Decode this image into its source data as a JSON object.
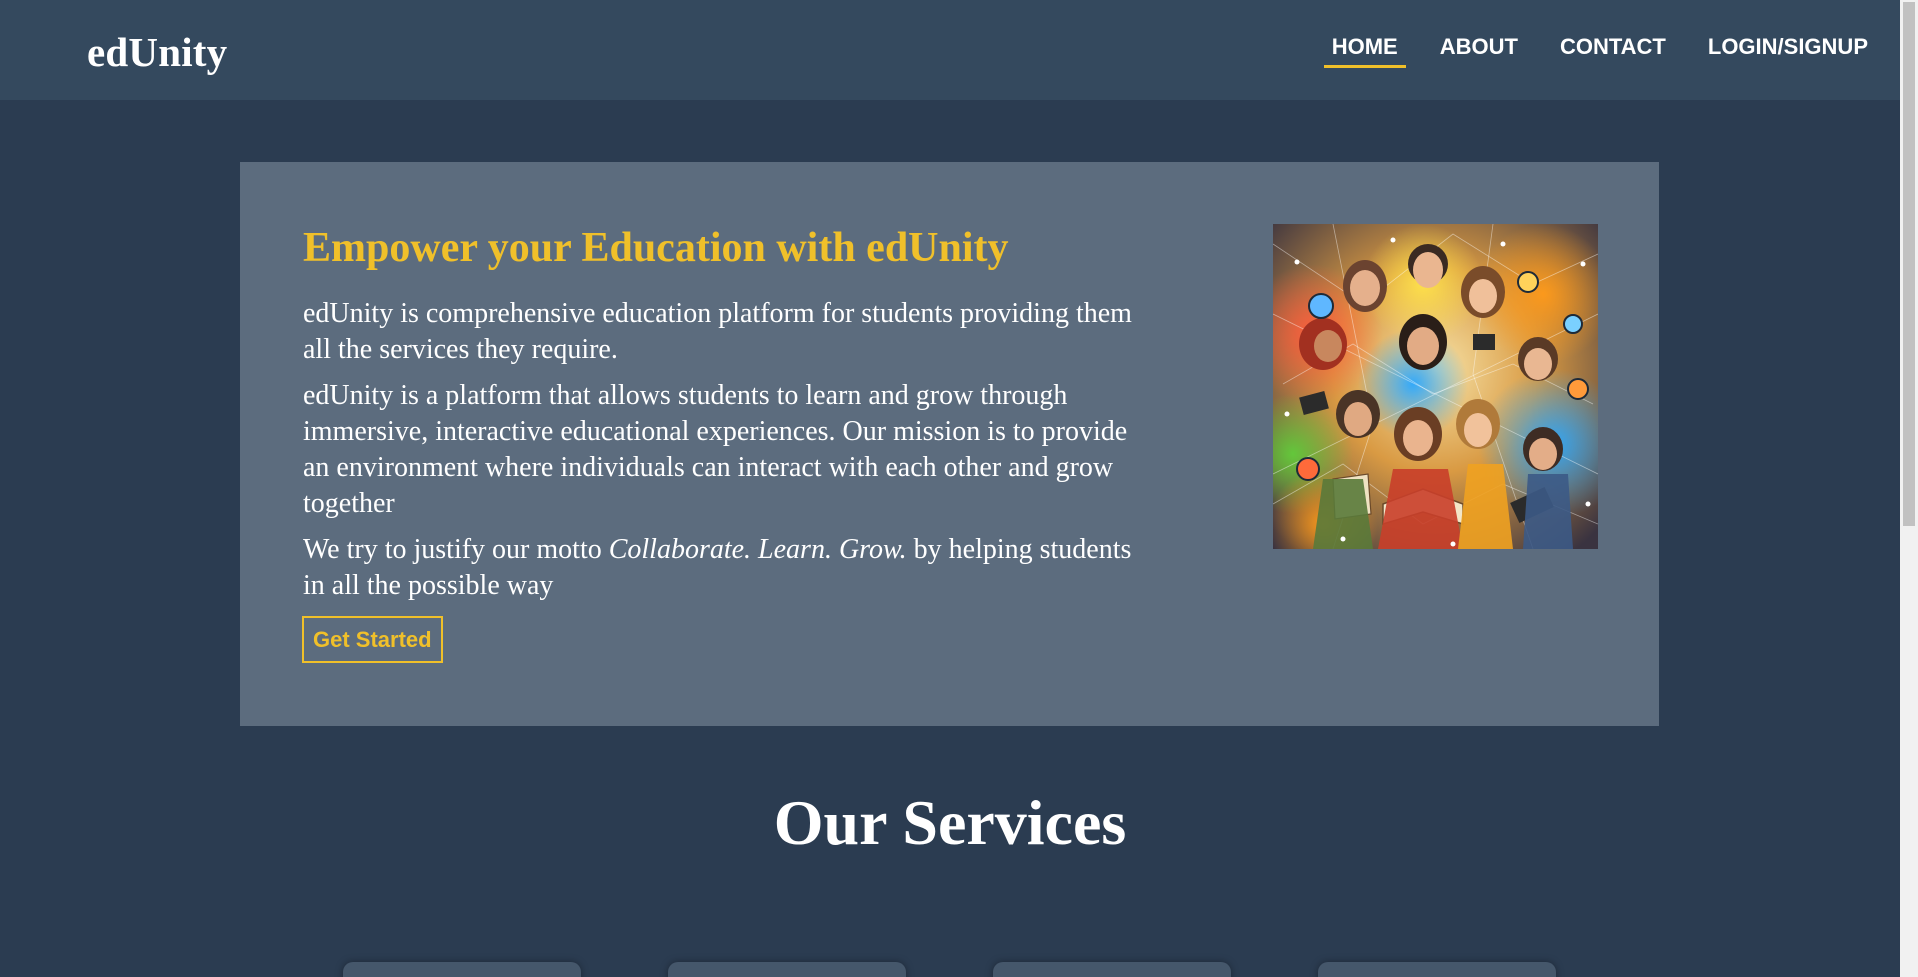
{
  "header": {
    "logo": "edUnity",
    "nav": [
      {
        "label": "HOME",
        "active": true
      },
      {
        "label": "ABOUT",
        "active": false
      },
      {
        "label": "CONTACT",
        "active": false
      },
      {
        "label": "LOGIN/SIGNUP",
        "active": false
      }
    ]
  },
  "hero": {
    "title": "Empower your Education with edUnity",
    "paragraph1": "edUnity is comprehensive education platform for students providing them all the services they require.",
    "paragraph2": "edUnity is a platform that allows students to learn and grow through immersive, interactive educational experiences. Our mission is to provide an environment where individuals can interact with each other and grow together",
    "paragraph3_before": "We try to justify our motto ",
    "paragraph3_motto": "Collaborate. Learn. Grow.",
    "paragraph3_after": " by helping students in all the possible way",
    "cta_label": "Get Started"
  },
  "services": {
    "title": "Our Services"
  },
  "colors": {
    "background": "#2b3c51",
    "header": "#34495e",
    "hero_panel": "#5c6c7e",
    "accent": "#f0c02a"
  }
}
